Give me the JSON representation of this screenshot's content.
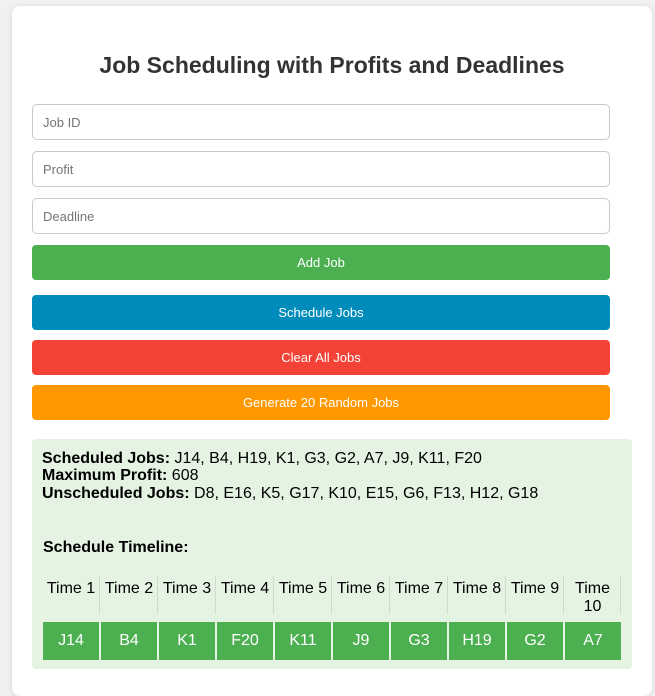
{
  "title": "Job Scheduling with Profits and Deadlines",
  "form": {
    "job_id_placeholder": "Job ID",
    "profit_placeholder": "Profit",
    "deadline_placeholder": "Deadline"
  },
  "buttons": {
    "add": "Add Job",
    "schedule": "Schedule Jobs",
    "clear": "Clear All Jobs",
    "random": "Generate 20 Random Jobs"
  },
  "colors": {
    "add": "#4caf50",
    "schedule": "#008cba",
    "clear": "#f44336",
    "random": "#ff9800",
    "results_bg": "#e5f3e3",
    "job_cell": "#4caf50"
  },
  "results": {
    "scheduled_label": "Scheduled Jobs:",
    "scheduled_value": "J14, B4, H19, K1, G3, G2, A7, J9, K11, F20",
    "profit_label": "Maximum Profit:",
    "profit_value": "608",
    "unscheduled_label": "Unscheduled Jobs:",
    "unscheduled_value": "D8, E16, K5, G17, K10, E15, G6, F13, H12, G18",
    "timeline_title": "Schedule Timeline:",
    "times": [
      "Time 1",
      "Time 2",
      "Time 3",
      "Time 4",
      "Time 5",
      "Time 6",
      "Time 7",
      "Time 8",
      "Time 9",
      "Time 10"
    ],
    "jobs": [
      "J14",
      "B4",
      "K1",
      "F20",
      "K11",
      "J9",
      "G3",
      "H19",
      "G2",
      "A7"
    ]
  }
}
